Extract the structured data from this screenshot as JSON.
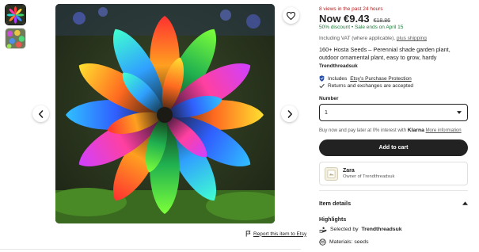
{
  "listing": {
    "views_notice": "8 views in the past 24 hours",
    "price_now": "Now €9.43",
    "price_original": "€18.86",
    "discount_note": "50% discount",
    "sale_note": "Sale ends on April 15",
    "vat_text": "Including VAT (where applicable),",
    "shipping_link": "plus shipping",
    "title": "160+ Hosta Seeds – Perennial shade garden plant, outdoor ornamental plant, easy to grow, hardy",
    "shop_name": "Trendthreadsuk"
  },
  "features": {
    "purchase_prefix": "Includes",
    "purchase_link": "Etsy's Purchase Protection",
    "returns_text": "Returns and exchanges are accepted"
  },
  "options": {
    "number_label": "Number",
    "number_value": "1"
  },
  "klarna": {
    "prefix": "Buy now and pay later at 0% interest with",
    "brand": "Klarna",
    "more_link": "More information"
  },
  "cart": {
    "add_label": "Add to cart"
  },
  "seller": {
    "name": "Zara",
    "role": "Owner of Trendthreadsuk"
  },
  "details": {
    "header": "Item details",
    "highlights_title": "Highlights",
    "selected_prefix": "Selected by",
    "selected_shop": "Trendthreadsuk",
    "materials": "Materials: seeds"
  },
  "gallery": {
    "report_link": "Report this item to Etsy"
  },
  "icons": {
    "favorite": "heart-icon",
    "prev": "chevron-left-icon",
    "next": "chevron-right-icon",
    "report": "flag-icon",
    "protection": "shield-check-icon",
    "returns": "checkmark-icon",
    "dropdown": "caret-down-icon",
    "collapse": "chevron-up-icon",
    "selected": "hands-icon",
    "materials": "materials-icon"
  },
  "colors": {
    "sale_red": "#b71c1c",
    "discount_green": "#1f7a3a",
    "button_dark": "#222222"
  }
}
